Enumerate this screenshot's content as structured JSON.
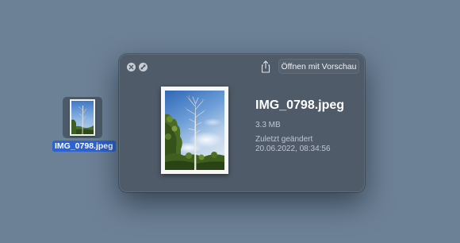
{
  "desktop": {
    "icon_label": "IMG_0798.jpeg",
    "background_color": "#6d8196",
    "selection_color": "#2d62d0"
  },
  "quicklook": {
    "filename": "IMG_0798.jpeg",
    "size": "3.3 MB",
    "modified_label": "Zuletzt geändert",
    "modified_value": "20.06.2022, 08:34:56",
    "open_button_label": "Öffnen mit Vorschau",
    "icons": {
      "close": "close-icon",
      "minimize": "minimize-icon",
      "share": "share-icon"
    },
    "panel_color": "#4f5b69"
  }
}
